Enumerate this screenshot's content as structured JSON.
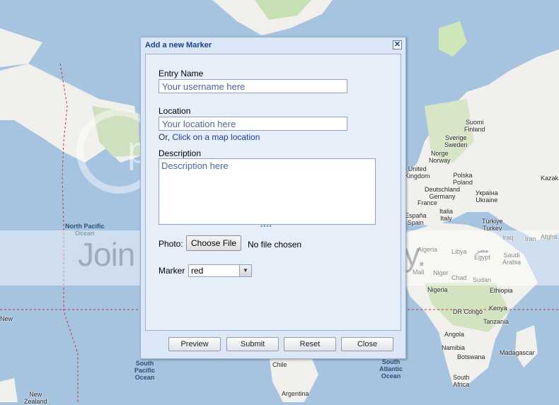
{
  "map": {
    "labels": [
      {
        "text": "Suomi",
        "sub": "Finland"
      },
      {
        "text": "Sverige",
        "sub": "Sweden"
      },
      {
        "text": "Norge",
        "sub": "Norway"
      },
      {
        "text": "United",
        "sub": "Kingdom"
      },
      {
        "text": "Polska",
        "sub": "Poland"
      },
      {
        "text": "Deutschland",
        "sub": "Germany"
      },
      {
        "text": "Україна",
        "sub": "Ukraine"
      },
      {
        "text": "France",
        "sub": ""
      },
      {
        "text": "Italia",
        "sub": "Italy"
      },
      {
        "text": "España",
        "sub": "Spain"
      },
      {
        "text": "Türkiye",
        "sub": "Turkey"
      },
      {
        "text": "Kazak",
        "sub": ""
      },
      {
        "text": "Afgha",
        "sub": ""
      },
      {
        "text": "Iraq",
        "sub": ""
      },
      {
        "text": "Iran",
        "sub": ""
      },
      {
        "text": "Algeria",
        "sub": ""
      },
      {
        "text": "Libya",
        "sub": ""
      },
      {
        "text": "مصر",
        "sub": "Egypt"
      },
      {
        "text": "Saudi",
        "sub": "Arabia"
      },
      {
        "text": "Mali",
        "sub": ""
      },
      {
        "text": "Niger",
        "sub": ""
      },
      {
        "text": "Chad",
        "sub": ""
      },
      {
        "text": "Sudan",
        "sub": ""
      },
      {
        "text": "Nigeria",
        "sub": ""
      },
      {
        "text": "Ethiopia",
        "sub": ""
      },
      {
        "text": "DR Congo",
        "sub": ""
      },
      {
        "text": "Kenya",
        "sub": ""
      },
      {
        "text": "Tanzania",
        "sub": ""
      },
      {
        "text": "Angola",
        "sub": ""
      },
      {
        "text": "Namibia",
        "sub": ""
      },
      {
        "text": "Botswana",
        "sub": ""
      },
      {
        "text": "Madagascar",
        "sub": ""
      },
      {
        "text": "South",
        "sub": "Africa"
      },
      {
        "text": "Chile",
        "sub": ""
      },
      {
        "text": "Argentina",
        "sub": ""
      },
      {
        "text": "New",
        "sub": ""
      },
      {
        "text": "New",
        "sub": "Zealand"
      }
    ],
    "oceans": [
      {
        "line1": "North Pacific",
        "line2": "Ocean"
      },
      {
        "line1": "South",
        "line2": "Pacific",
        "line3": "Ocean"
      },
      {
        "line1": "South",
        "line2": "Atlantic",
        "line3": "Ocean"
      }
    ]
  },
  "watermark": {
    "brand": "photobucket",
    "banner": "Join free. Share privately."
  },
  "dialog": {
    "title": "Add a new Marker",
    "close_glyph": "✕",
    "entry_name": {
      "label": "Entry Name",
      "placeholder": "Your username here"
    },
    "location": {
      "label": "Location",
      "placeholder": "Your location here",
      "or_text": "Or, ",
      "map_link": "Click on a map location"
    },
    "description": {
      "label": "Description",
      "placeholder": "Description here"
    },
    "photo": {
      "label": "Photo:",
      "button": "Choose File",
      "status": "No file chosen"
    },
    "marker": {
      "label": "Marker",
      "value": "red",
      "arrow_icon": "chevron-down-icon"
    },
    "buttons": {
      "preview": "Preview",
      "submit": "Submit",
      "reset": "Reset",
      "close": "Close"
    }
  }
}
